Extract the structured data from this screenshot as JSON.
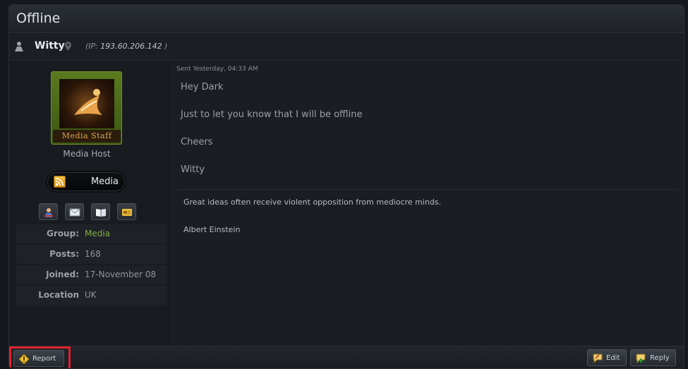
{
  "header": {
    "title": "Offline"
  },
  "author": {
    "username": "Witty",
    "ip_label": "(IP: ",
    "ip": "193.60.206.142",
    "ip_close": " )"
  },
  "sidebar": {
    "avatar_caption": "Media Staff",
    "rank": "Media Host",
    "group_badge": "Media",
    "action_icons": [
      "profile-icon",
      "message-icon",
      "book-icon",
      "card-icon"
    ],
    "stats": [
      {
        "label": "Group:",
        "value": "Media"
      },
      {
        "label": "Posts:",
        "value": "168"
      },
      {
        "label": "Joined:",
        "value": "17-November 08"
      },
      {
        "label": "Location",
        "value": "UK"
      }
    ]
  },
  "post": {
    "sent": "Sent Yesterday, 04:33 AM",
    "lines": [
      "Hey Dark",
      "Just to let you know that I will be offline",
      "Cheers",
      "Witty"
    ],
    "signature": [
      "Great ideas often receive violent opposition from mediocre minds.",
      "Albert Einstein"
    ]
  },
  "footer": {
    "report_label": "Report",
    "edit_label": "Edit",
    "reply_label": "Reply"
  },
  "colors": {
    "accent_green": "#7fb043",
    "highlight_red": "#e0202b"
  }
}
